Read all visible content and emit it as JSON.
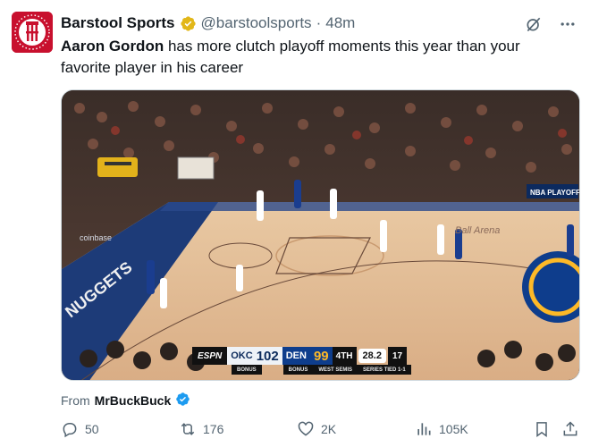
{
  "account": {
    "display_name": "Barstool Sports",
    "handle": "@barstoolsports",
    "separator": "·",
    "time": "48m"
  },
  "tweet": {
    "bold_part": "Aaron Gordon",
    "rest": " has more clutch playoff moments this year than your favorite player in his career"
  },
  "media": {
    "scorebug": {
      "network": "ESPN",
      "team1_abbr": "OKC",
      "team1_score": "102",
      "team2_abbr": "DEN",
      "team2_score": "99",
      "quarter": "4TH",
      "clock": "28.2",
      "shot_clock": "17",
      "team1_bonus": "BONUS",
      "team2_bonus": "BONUS",
      "series_info": "WEST SEMIS",
      "series_status": "SERIES TIED 1-1"
    },
    "arena_text": {
      "coinbase": "coinbase",
      "nuggets": "NUGGETS",
      "playoffs": "NBA PLAYOFFS",
      "ball_arena": "Ball Arena"
    }
  },
  "source": {
    "prefix": "From",
    "name": "MrBuckBuck"
  },
  "actions": {
    "replies": "50",
    "reposts": "176",
    "likes": "2K",
    "views": "105K"
  },
  "colors": {
    "accent": "#1d9bf0",
    "muted": "#536471",
    "gold_verified": "#e2b719",
    "brand": "#c8102e"
  }
}
